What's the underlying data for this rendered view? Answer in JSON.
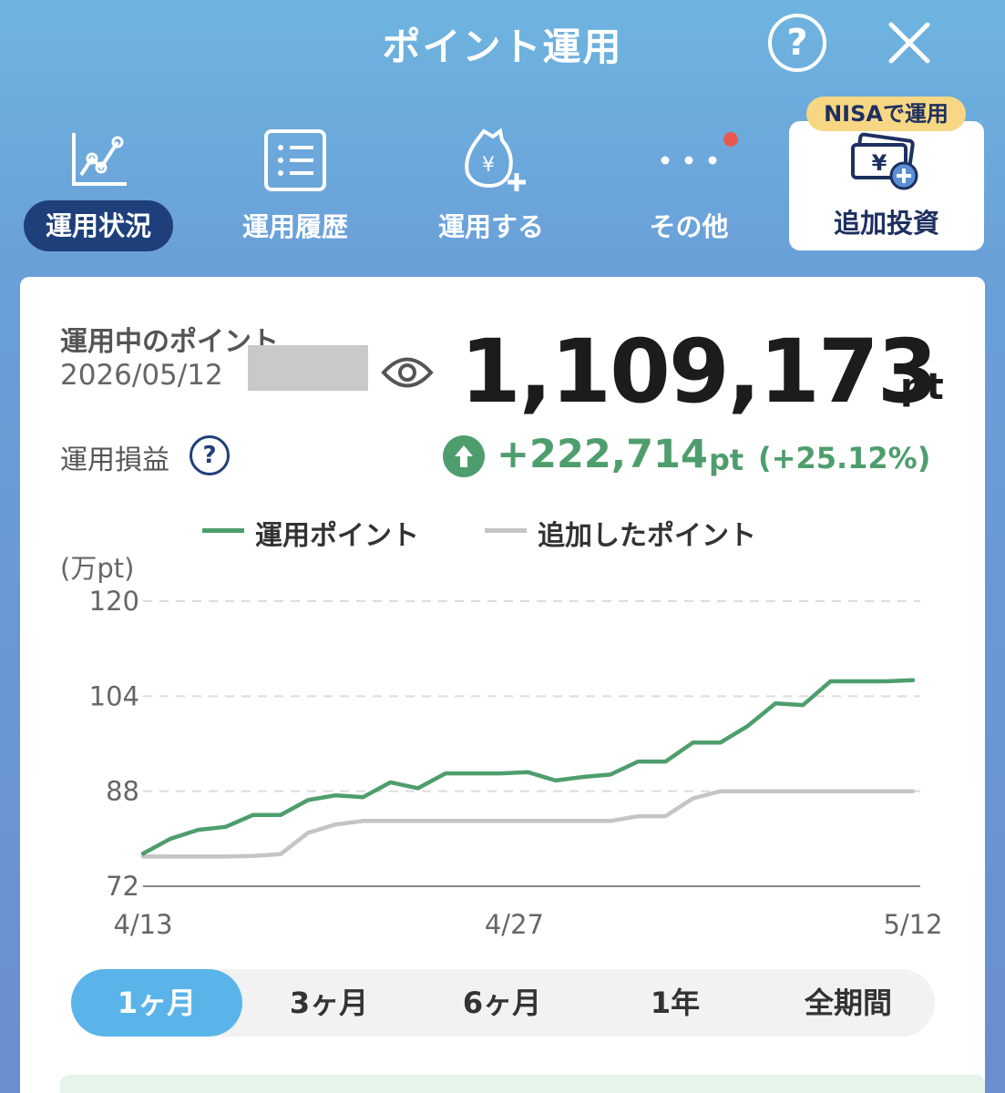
{
  "header": {
    "title": "ポイント運用",
    "help_label": "?"
  },
  "nav": {
    "items": [
      {
        "label": "運用状況",
        "icon": "line-chart-icon",
        "active": true
      },
      {
        "label": "運用履歴",
        "icon": "list-icon",
        "active": false
      },
      {
        "label": "運用する",
        "icon": "money-bag-plus-icon",
        "active": false
      },
      {
        "label": "その他",
        "icon": "more-dots-icon",
        "active": false
      }
    ],
    "nisa": {
      "badge": "NISAで運用",
      "label": "追加投資",
      "icon": "yen-cash-plus-icon"
    }
  },
  "summary": {
    "holding_label": "運用中のポイント",
    "date": "2026/05/12",
    "points": "1,109,173",
    "points_unit": "pt",
    "pl_label": "運用損益",
    "pl_help": "?",
    "pl_value": "+222,714",
    "pl_unit": "pt",
    "pl_percent": "(+25.12%)"
  },
  "colors": {
    "green": "#4e9e6d",
    "gray": "#c4c4c4",
    "navy": "#1e3f7a",
    "blue": "#5ab4ea"
  },
  "chart_data": {
    "type": "line",
    "ylabel": "(万pt)",
    "ylim": [
      72,
      120
    ],
    "yticks": [
      "120",
      "104",
      "88",
      "72"
    ],
    "xticks": [
      "4/13",
      "4/27",
      "5/12"
    ],
    "series": [
      {
        "name": "運用ポイント",
        "values": [
          77.5,
          80,
          81.5,
          82,
          84,
          84,
          86.5,
          87.3,
          87,
          89.5,
          88.5,
          91,
          91,
          91,
          91.2,
          89.8,
          90.4,
          90.8,
          93,
          93,
          96.2,
          96.2,
          99,
          102.8,
          102.5,
          106.5,
          106.5,
          106.5,
          106.7
        ]
      },
      {
        "name": "追加したポイント",
        "values": [
          77,
          77,
          77,
          77,
          77.1,
          77.4,
          81,
          82.4,
          83,
          83,
          83,
          83,
          83,
          83,
          83,
          83,
          83,
          83,
          83.8,
          83.8,
          86.8,
          88,
          88,
          88,
          88,
          88,
          88,
          88,
          88
        ]
      }
    ]
  },
  "periods": [
    {
      "label": "1ヶ月",
      "active": true
    },
    {
      "label": "3ヶ月",
      "active": false
    },
    {
      "label": "6ヶ月",
      "active": false
    },
    {
      "label": "1年",
      "active": false
    },
    {
      "label": "全期間",
      "active": false
    }
  ]
}
